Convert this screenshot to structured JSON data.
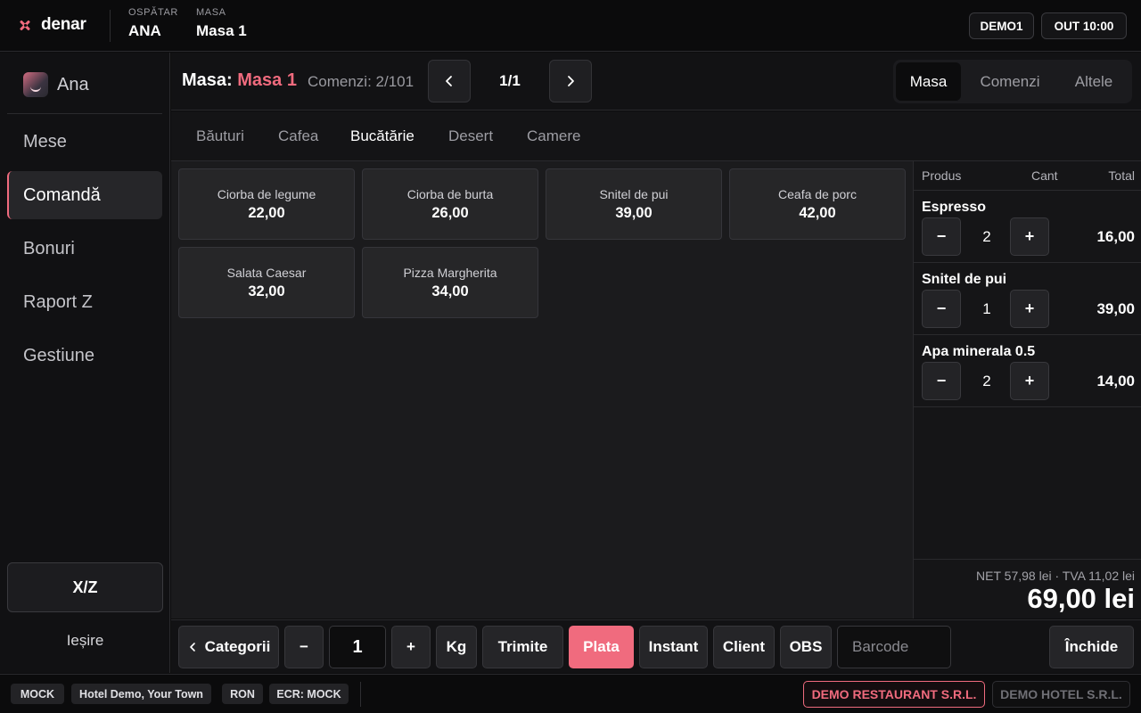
{
  "header": {
    "brand": "denar",
    "waiter_label": "OSPĂTAR",
    "waiter_value": "ANA",
    "table_label": "MASA",
    "table_value": "Masa 1",
    "chip_user": "DEMO1",
    "chip_out": "OUT 10:00"
  },
  "sidebar": {
    "user": "Ana",
    "items": [
      {
        "label": "Mese"
      },
      {
        "label": "Comandă"
      },
      {
        "label": "Bonuri"
      },
      {
        "label": "Raport Z"
      },
      {
        "label": "Gestiune"
      }
    ],
    "active_index": 1,
    "xz_label": "X/Z",
    "exit_label": "Ieșire"
  },
  "table_bar": {
    "title_prefix": "Masa:",
    "title_value": "Masa 1",
    "orders_text": "Comenzi: 2/101",
    "pager": "1/1",
    "segments": [
      "Masa",
      "Comenzi",
      "Altele"
    ],
    "active_segment": 0
  },
  "categories": {
    "tabs": [
      "Băuturi",
      "Cafea",
      "Bucătărie",
      "Desert",
      "Camere"
    ],
    "active_index": 2
  },
  "products": [
    {
      "name": "Ciorba de legume",
      "price": "22,00"
    },
    {
      "name": "Ciorba de burta",
      "price": "26,00"
    },
    {
      "name": "Snitel de pui",
      "price": "39,00"
    },
    {
      "name": "Ceafa de porc",
      "price": "42,00"
    },
    {
      "name": "Salata Caesar",
      "price": "32,00"
    },
    {
      "name": "Pizza Margherita",
      "price": "34,00"
    }
  ],
  "order": {
    "columns": {
      "product": "Produs",
      "qty": "Cant",
      "total": "Total"
    },
    "lines": [
      {
        "name": "Espresso",
        "qty": "2",
        "total": "16,00"
      },
      {
        "name": "Snitel de pui",
        "qty": "1",
        "total": "39,00"
      },
      {
        "name": "Apa minerala 0.5",
        "qty": "2",
        "total": "14,00"
      }
    ],
    "minus": "−",
    "plus": "+",
    "summary": "NET 57,98 lei · TVA 11,02 lei",
    "total": "69,00 lei"
  },
  "actions": {
    "categories": "Categorii",
    "minus": "−",
    "qty": "1",
    "plus": "+",
    "kg": "Kg",
    "send": "Trimite",
    "pay": "Plata",
    "instant": "Instant",
    "client": "Client",
    "obs": "OBS",
    "barcode_placeholder": "Barcode",
    "close": "Închide"
  },
  "footer": {
    "chips": [
      "MOCK",
      "Hotel Demo, Your Town",
      "RON",
      "ECR: MOCK"
    ],
    "company_active": "DEMO RESTAURANT S.R.L.",
    "company_inactive": "DEMO HOTEL S.R.L."
  },
  "colors": {
    "accent": "#f06b7e",
    "background": "#0d0d0e",
    "panel": "#151517"
  }
}
